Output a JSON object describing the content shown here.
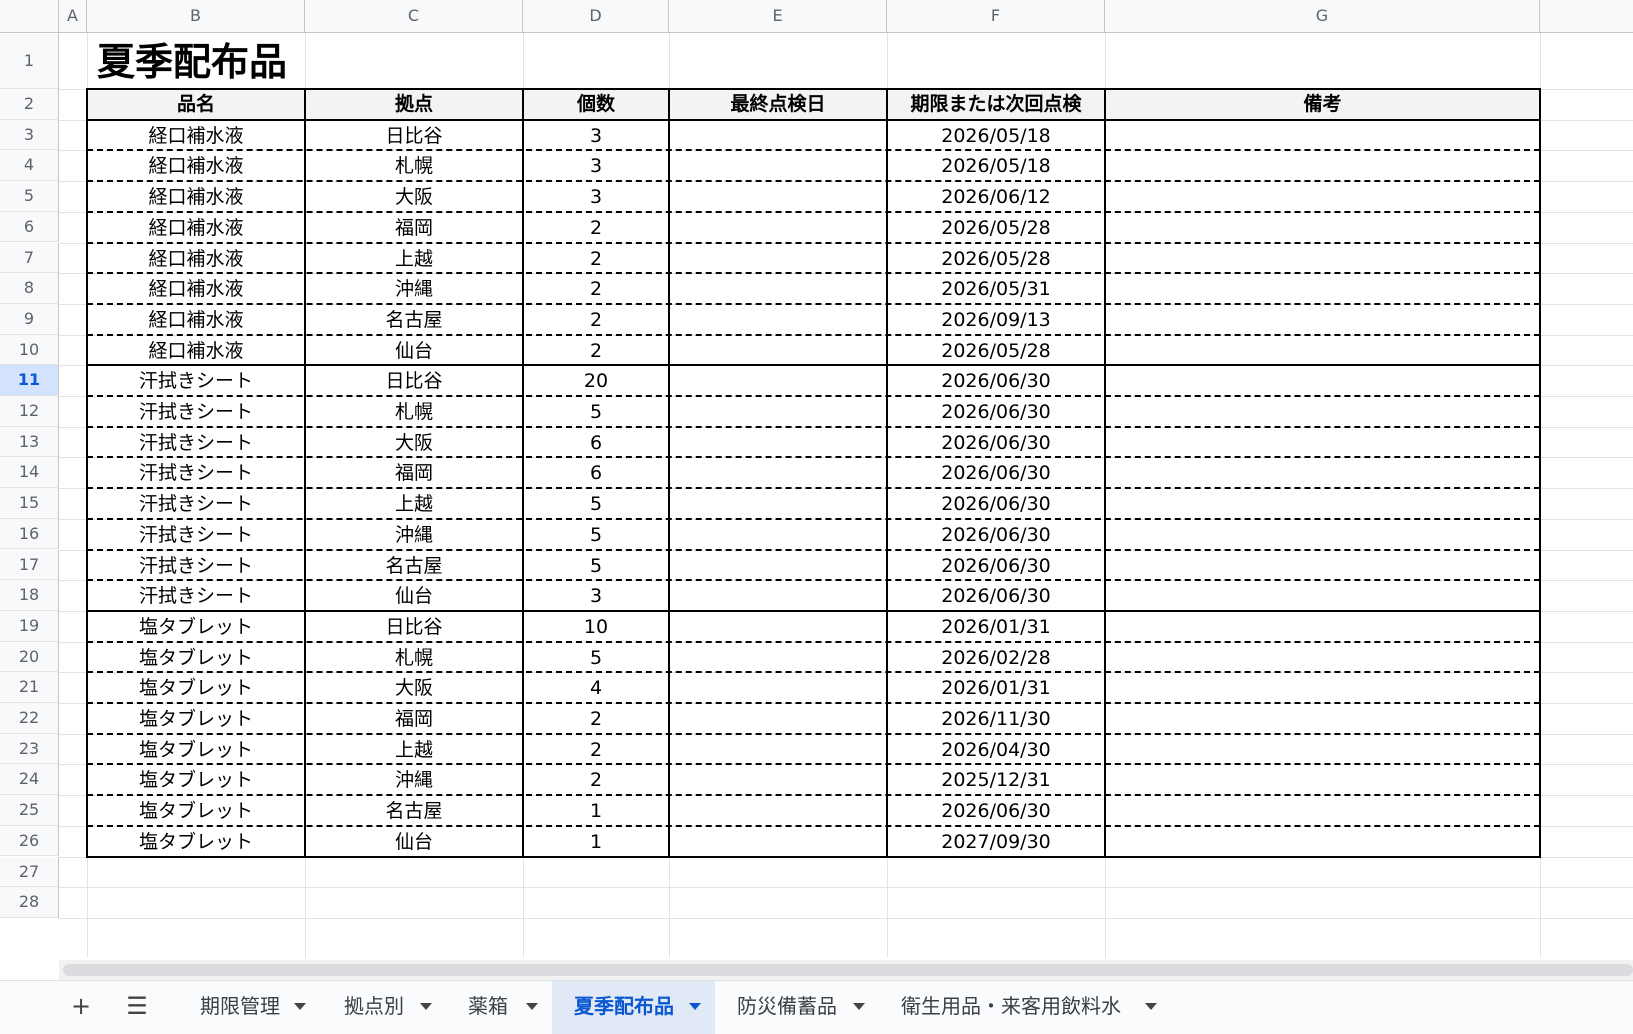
{
  "sheet": {
    "columns": [
      "A",
      "B",
      "C",
      "D",
      "E",
      "F",
      "G"
    ],
    "row_numbers": [
      "1",
      "2",
      "3",
      "4",
      "5",
      "6",
      "7",
      "8",
      "9",
      "10",
      "11",
      "12",
      "13",
      "14",
      "15",
      "16",
      "17",
      "18",
      "19",
      "20",
      "21",
      "22",
      "23",
      "24",
      "25",
      "26",
      "27",
      "28"
    ],
    "selected_row": "11",
    "title": "夏季配布品",
    "headers": [
      "品名",
      "拠点",
      "個数",
      "最終点検日",
      "期限または次回点検",
      "備考"
    ],
    "rows": [
      [
        "経口補水液",
        "日比谷",
        "3",
        "",
        "2026/05/18",
        ""
      ],
      [
        "経口補水液",
        "札幌",
        "3",
        "",
        "2026/05/18",
        ""
      ],
      [
        "経口補水液",
        "大阪",
        "3",
        "",
        "2026/06/12",
        ""
      ],
      [
        "経口補水液",
        "福岡",
        "2",
        "",
        "2026/05/28",
        ""
      ],
      [
        "経口補水液",
        "上越",
        "2",
        "",
        "2026/05/28",
        ""
      ],
      [
        "経口補水液",
        "沖縄",
        "2",
        "",
        "2026/05/31",
        ""
      ],
      [
        "経口補水液",
        "名古屋",
        "2",
        "",
        "2026/09/13",
        ""
      ],
      [
        "経口補水液",
        "仙台",
        "2",
        "",
        "2026/05/28",
        ""
      ],
      [
        "汗拭きシート",
        "日比谷",
        "20",
        "",
        "2026/06/30",
        ""
      ],
      [
        "汗拭きシート",
        "札幌",
        "5",
        "",
        "2026/06/30",
        ""
      ],
      [
        "汗拭きシート",
        "大阪",
        "6",
        "",
        "2026/06/30",
        ""
      ],
      [
        "汗拭きシート",
        "福岡",
        "6",
        "",
        "2026/06/30",
        ""
      ],
      [
        "汗拭きシート",
        "上越",
        "5",
        "",
        "2026/06/30",
        ""
      ],
      [
        "汗拭きシート",
        "沖縄",
        "5",
        "",
        "2026/06/30",
        ""
      ],
      [
        "汗拭きシート",
        "名古屋",
        "5",
        "",
        "2026/06/30",
        ""
      ],
      [
        "汗拭きシート",
        "仙台",
        "3",
        "",
        "2026/06/30",
        ""
      ],
      [
        "塩タブレット",
        "日比谷",
        "10",
        "",
        "2026/01/31",
        ""
      ],
      [
        "塩タブレット",
        "札幌",
        "5",
        "",
        "2026/02/28",
        ""
      ],
      [
        "塩タブレット",
        "大阪",
        "4",
        "",
        "2026/01/31",
        ""
      ],
      [
        "塩タブレット",
        "福岡",
        "2",
        "",
        "2026/11/30",
        ""
      ],
      [
        "塩タブレット",
        "上越",
        "2",
        "",
        "2026/04/30",
        ""
      ],
      [
        "塩タブレット",
        "沖縄",
        "2",
        "",
        "2025/12/31",
        ""
      ],
      [
        "塩タブレット",
        "名古屋",
        "1",
        "",
        "2026/06/30",
        ""
      ],
      [
        "塩タブレット",
        "仙台",
        "1",
        "",
        "2027/09/30",
        ""
      ]
    ]
  },
  "tabbar": {
    "add_icon": "plus-icon",
    "add_glyph": "+",
    "menu_icon": "hamburger-menu-icon",
    "menu_glyph": "☰",
    "tabs": [
      {
        "label": "期限管理",
        "active": false
      },
      {
        "label": "拠点別",
        "active": false
      },
      {
        "label": "薬箱",
        "active": false
      },
      {
        "label": "夏季配布品",
        "active": true
      },
      {
        "label": "防災備蓄品",
        "active": false
      },
      {
        "label": "衛生用品・来客用飲料水",
        "active": false
      }
    ],
    "active_color": "#0b57d0"
  }
}
